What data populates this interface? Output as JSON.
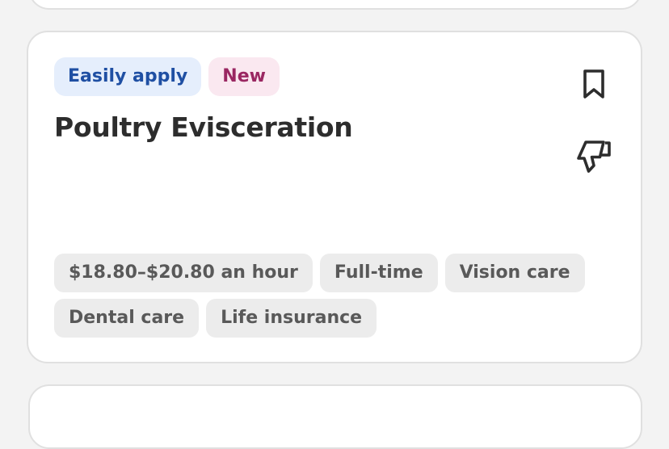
{
  "job_card": {
    "badges": {
      "easily_apply": "Easily apply",
      "new": "New"
    },
    "title": "Poultry Evisceration",
    "tags": [
      "$18.80–$20.80 an hour",
      "Full-time",
      "Vision care",
      "Dental care",
      "Life insurance"
    ],
    "icons": {
      "bookmark": "bookmark-icon",
      "dislike": "thumbs-down-icon"
    }
  },
  "colors": {
    "page_background": "#f3f3f3",
    "card_background": "#ffffff",
    "card_border": "#e0e0e0",
    "easily_apply_bg": "#e5eefc",
    "easily_apply_text": "#1f4fa3",
    "new_bg": "#fae8f0",
    "new_text": "#9a2762",
    "tag_bg": "#ececec",
    "tag_text": "#595959",
    "title_text": "#2d2d2d"
  }
}
